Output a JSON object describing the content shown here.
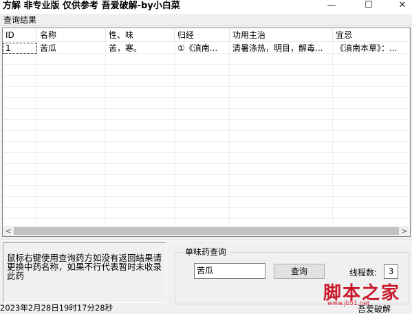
{
  "window": {
    "title": "方解 非专业版  仅供参考 吾爱破解-by小白菜",
    "min_icon": "—",
    "max_icon": "☐",
    "close_icon": "✕"
  },
  "results": {
    "label": "查询结果",
    "columns": [
      "ID",
      "名称",
      "性、味",
      "归经",
      "功用主治",
      "宜忌"
    ],
    "rows": [
      [
        "1",
        "苦瓜",
        "苦，寒。",
        "①《滇南...",
        "清暑涤热，明目，解毒...",
        "《滇南本草》：..."
      ]
    ]
  },
  "scrollbar": {
    "left_arrow": "<",
    "right_arrow": ">"
  },
  "hint": {
    "text": "鼠标右键使用查询药方如没有返回结果请更换中药名称，如果不行代表暂时未收录此药"
  },
  "query": {
    "group_label": "单味药查询",
    "input_value": "苦瓜",
    "button_label": "查询",
    "thread_label": "线程数:",
    "thread_value": "3"
  },
  "status": {
    "time": "2023年2月28日19时17分28秒",
    "right_text": "吾爱破解"
  },
  "watermark": {
    "big": "脚本之家",
    "small": "www.jb51.net"
  }
}
